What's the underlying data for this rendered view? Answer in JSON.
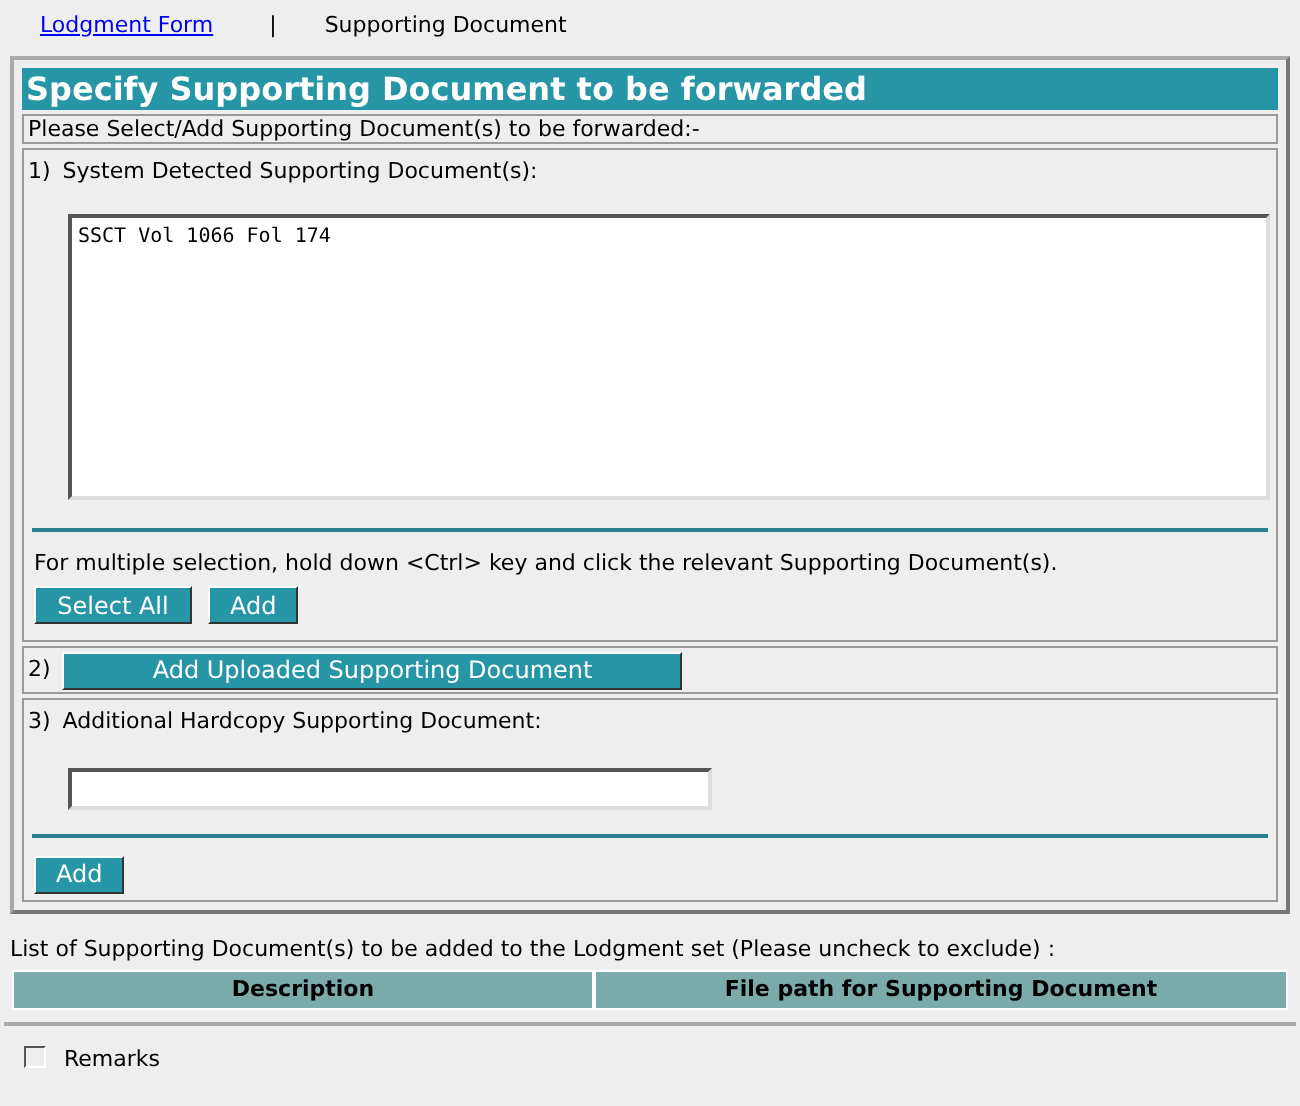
{
  "nav": [
    {
      "label": "Lodgment Form",
      "kind": "link"
    },
    {
      "label": "|",
      "kind": "separator"
    },
    {
      "label": "Supporting Document",
      "kind": "text"
    }
  ],
  "panel": {
    "title": "Specify Supporting Document to be forwarded",
    "instruction": "Please Select/Add Supporting Document(s) to be forwarded:-",
    "section1": {
      "number": "1)",
      "label": "System Detected Supporting Document(s):",
      "items": [
        {
          "label": "SSCT Vol 1066 Fol 174",
          "selected": false
        }
      ],
      "hint": "For multiple selection, hold down <Ctrl> key and click the relevant Supporting Document(s).",
      "buttons": [
        "Select All",
        "Add"
      ]
    },
    "section2": {
      "number": "2)",
      "button": "Add Uploaded Supporting Document"
    },
    "section3": {
      "number": "3)",
      "label": "Additional Hardcopy Supporting Document:",
      "button": "Add"
    }
  },
  "list": {
    "caption": "List of Supporting Document(s) to be added to the Lodgment set (Please uncheck to exclude) :",
    "columns": [
      "Description",
      "File path for Supporting Document"
    ]
  },
  "remarks": {
    "label": "Remarks",
    "checked": false
  }
}
